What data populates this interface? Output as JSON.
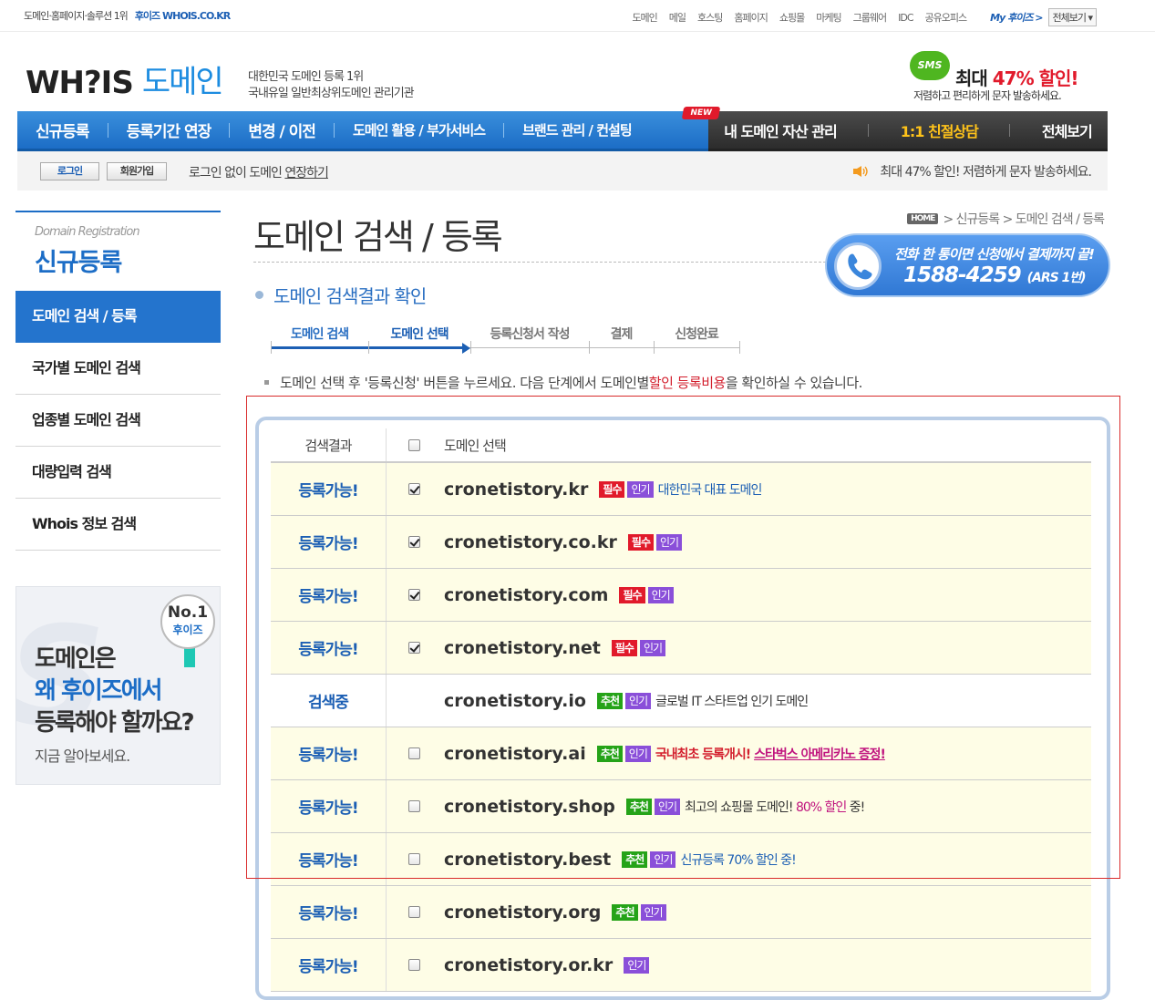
{
  "util": {
    "left_text": "도메인·홈페이지·솔루션 1위",
    "brand": "후이즈 WHOIS.CO.KR",
    "menu": [
      "도메인",
      "메일",
      "호스팅",
      "홈페이지",
      "쇼핑몰",
      "마케팅",
      "그룹웨어",
      "IDC",
      "공유오피스"
    ],
    "my_whois": "My 후이즈 >",
    "view_all": "전체보기 ▾"
  },
  "logo": {
    "whois": "WH?IS",
    "domain": "도메인"
  },
  "tagline": {
    "line1": "대한민국 도메인 등록 1위",
    "line2": "국내유일 일반최상위도메인 관리기관"
  },
  "sms": {
    "bubble": "SMS",
    "headline_pre": "최대 ",
    "headline_pct": "47% 할인!",
    "sub": "저렴하고 편리하게 문자 발송하세요."
  },
  "gnb": {
    "blue_items": [
      "신규등록",
      "등록기간 연장",
      "변경 / 이전",
      "도메인 활용 / 부가서비스",
      "브랜드 관리 / 컨설팅"
    ],
    "new_badge": "NEW",
    "dark_items": [
      "내 도메인 자산 관리",
      "1:1 친절상담",
      "전체보기"
    ]
  },
  "bar2": {
    "login": "로그인",
    "join": "회원가입",
    "text_pre": "로그인 없이 도메인 ",
    "text_link": "연장하기",
    "right_text": "최대 47% 할인! 저렴하게 문자 발송하세요."
  },
  "lnb": {
    "en": "Domain Registration",
    "ko": "신규등록",
    "items": [
      "도메인 검색 / 등록",
      "국가별 도메인 검색",
      "업종별 도메인 검색",
      "대량입력 검색",
      "Whois 정보 검색"
    ]
  },
  "promo": {
    "no1": "No.1",
    "brand": "후이즈",
    "line1": "도메인은",
    "line2": "왜 후이즈에서",
    "line3": "등록해야 할까요?",
    "sub": "지금 알아보세요."
  },
  "page": {
    "title": "도메인 검색 / 등록",
    "crumb_home": "HOME",
    "crumb": "> 신규등록 > 도메인 검색 / 등록",
    "section": "도메인 검색결과 확인"
  },
  "call": {
    "line1": "전화 한 통이면 신청에서 결제까지 끝!",
    "phone": "1588-4259",
    "ars": "(ARS 1번)"
  },
  "steps": [
    "도메인 검색",
    "도메인 선택",
    "등록신청서 작성",
    "결제",
    "신청완료"
  ],
  "notice": {
    "pre": "도메인 선택 후 '등록신청' 버튼을 누르세요. 다음 단계에서 도메인별 ",
    "red": "할인 등록비용",
    "post": "을 확인하실 수 있습니다."
  },
  "table": {
    "headers": {
      "status": "검색결과",
      "select": "도메인 선택"
    },
    "rows": [
      {
        "status": "등록가능!",
        "checked": true,
        "domain": "cronetistory.kr",
        "badges": [
          "필수",
          "인기"
        ],
        "desc": "대한민국 대표 도메인"
      },
      {
        "status": "등록가능!",
        "checked": true,
        "domain": "cronetistory.co.kr",
        "badges": [
          "필수",
          "인기"
        ],
        "desc": ""
      },
      {
        "status": "등록가능!",
        "checked": true,
        "domain": "cronetistory.com",
        "badges": [
          "필수",
          "인기"
        ],
        "desc": ""
      },
      {
        "status": "등록가능!",
        "checked": true,
        "domain": "cronetistory.net",
        "badges": [
          "필수",
          "인기"
        ],
        "desc": ""
      },
      {
        "status": "검색중",
        "checked": null,
        "domain": "cronetistory.io",
        "badges": [
          "추천",
          "인기"
        ],
        "desc": "글로벌 IT 스타트업 인기 도메인"
      },
      {
        "status": "등록가능!",
        "checked": false,
        "domain": "cronetistory.ai",
        "badges": [
          "추천",
          "인기"
        ],
        "desc_red": "국내최초 등록개시! ",
        "desc_link": "스타벅스 아메리카노 증정!"
      },
      {
        "status": "등록가능!",
        "checked": false,
        "domain": "cronetistory.shop",
        "badges": [
          "추천",
          "인기"
        ],
        "desc_pre": "최고의 쇼핑몰 도메인! ",
        "desc_mg": "80% 할인",
        "desc_post": " 중!"
      },
      {
        "status": "등록가능!",
        "checked": false,
        "domain": "cronetistory.best",
        "badges": [
          "추천",
          "인기"
        ],
        "desc": "신규등록 70% 할인 중!"
      },
      {
        "status": "등록가능!",
        "checked": false,
        "domain": "cronetistory.org",
        "badges": [
          "추천",
          "인기"
        ],
        "desc": ""
      },
      {
        "status": "등록가능!",
        "checked": false,
        "domain": "cronetistory.or.kr",
        "badges": [
          "인기"
        ],
        "desc": ""
      }
    ]
  }
}
